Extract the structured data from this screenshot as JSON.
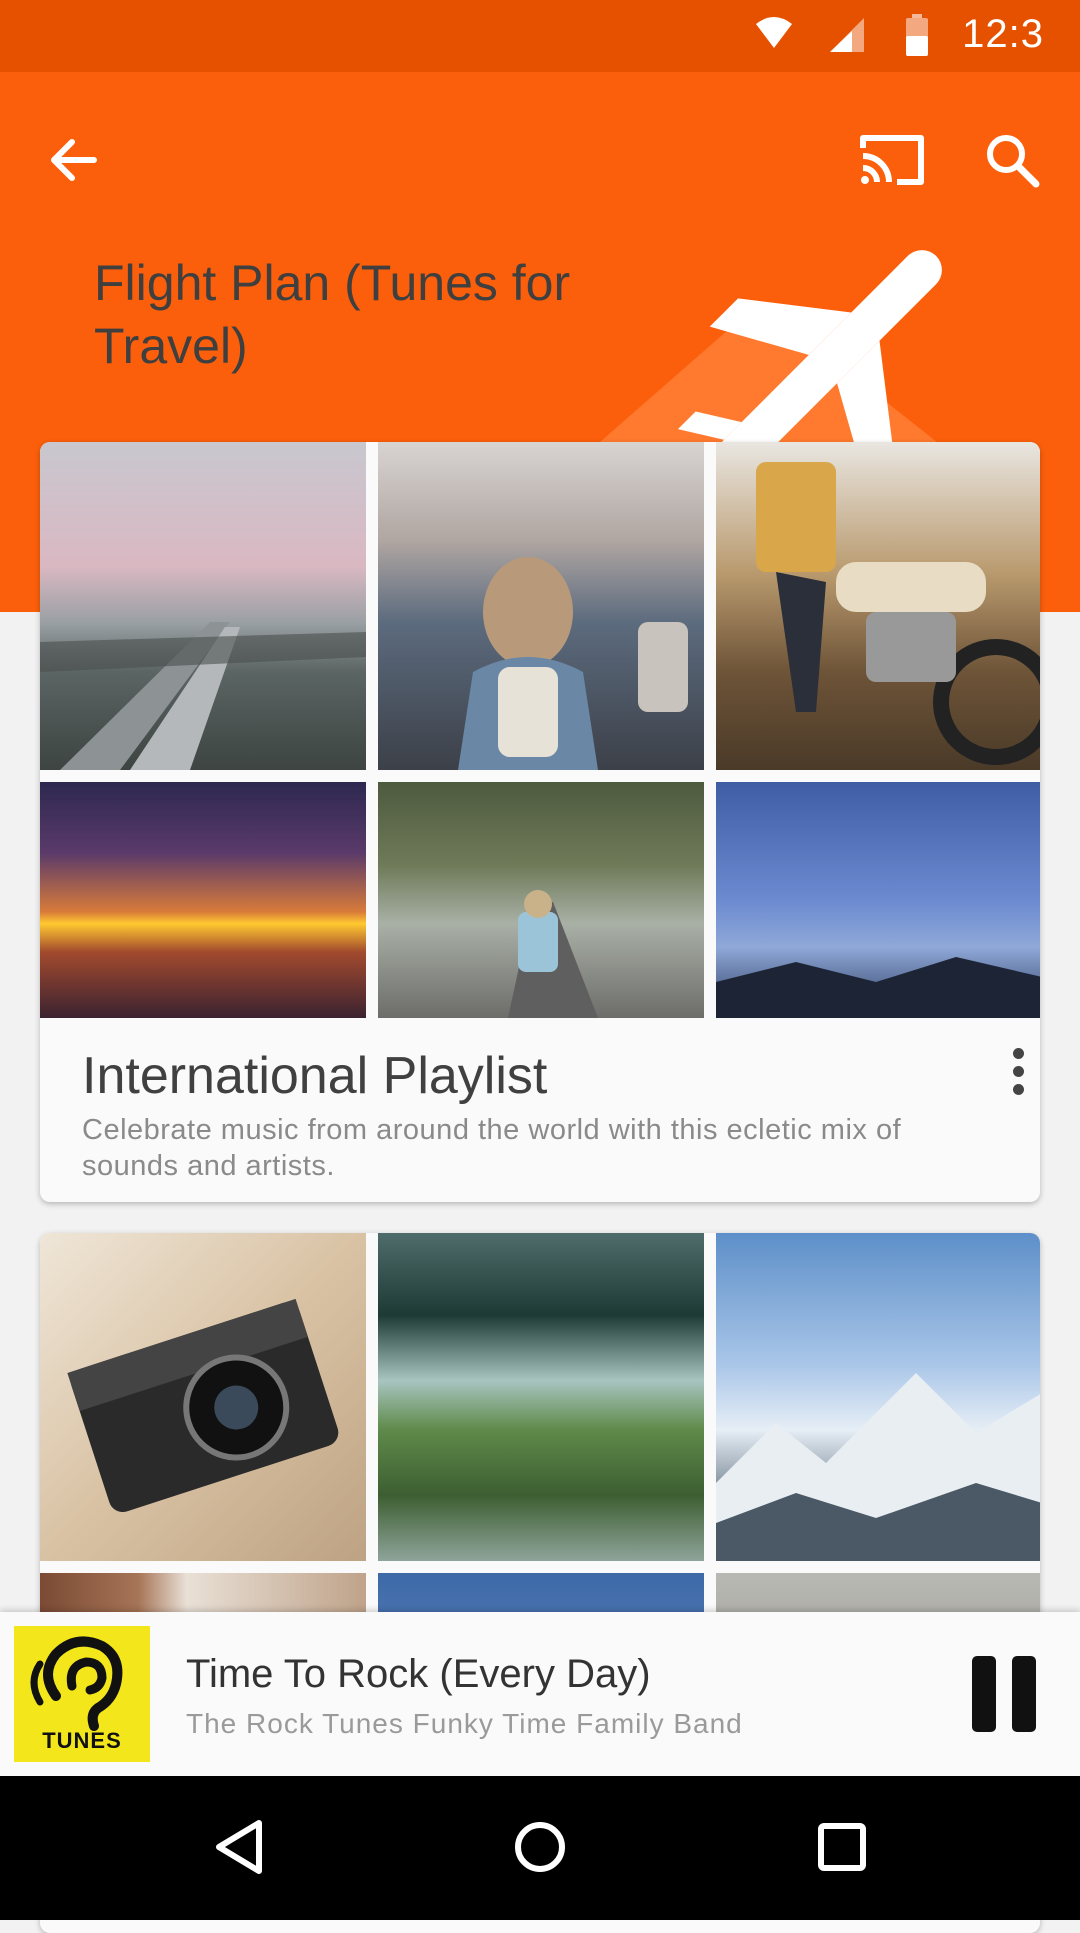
{
  "status_bar": {
    "time": "12:3",
    "icons": [
      "wifi-icon",
      "signal-icon",
      "battery-icon"
    ]
  },
  "header": {
    "title": "Flight Plan (Tunes for Travel)",
    "icons": [
      "back-arrow-icon",
      "cast-icon",
      "search-icon",
      "airplane-icon"
    ],
    "colors": {
      "background": "#fb5f0b",
      "status_bar": "#e65100"
    }
  },
  "playlists": [
    {
      "title": "International Playlist",
      "description": "Celebrate music from around the world with this ecletic mix of sounds and artists.",
      "images": [
        "city-highway-sunset",
        "street-traffic-backpacker",
        "motorcycle-rider",
        "ocean-sunset",
        "tree-lined-road-cyclist",
        "blue-sky-mountains"
      ]
    },
    {
      "images": [
        "vintage-camera-map",
        "misty-green-hills",
        "snowy-mountain-range",
        "wooden-building",
        "blue-sky",
        "bare-trees"
      ]
    }
  ],
  "now_playing": {
    "art_label": "TUNES",
    "title": "Time To Rock (Every Day)",
    "artist": "The Rock Tunes Funky Time Family Band",
    "icons": [
      "ear-logo-icon",
      "pause-icon"
    ]
  },
  "nav_bar": {
    "icons": [
      "back-triangle-icon",
      "home-circle-icon",
      "recents-square-icon"
    ]
  }
}
